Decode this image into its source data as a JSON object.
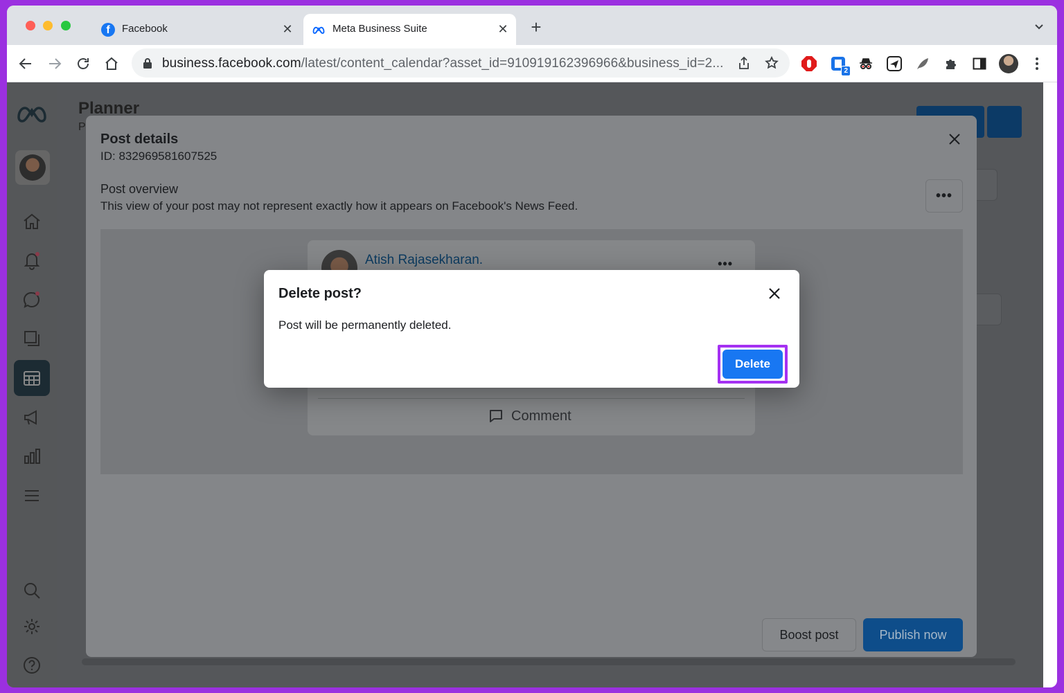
{
  "browser": {
    "tabs": [
      {
        "title": "Facebook",
        "favicon": "facebook-icon",
        "active": false
      },
      {
        "title": "Meta Business Suite",
        "favicon": "meta-icon",
        "active": true
      }
    ],
    "url_host": "business.facebook.com",
    "url_path": "/latest/content_calendar?asset_id=910919162396966&business_id=2...",
    "extension_badge": "2",
    "colors": {
      "tabstrip": "#dee1e6",
      "omnibox": "#f1f3f4",
      "frame": "#9b30e0"
    }
  },
  "page": {
    "planner_title": "Planner",
    "planner_sub": "P"
  },
  "post_details": {
    "title": "Post details",
    "id_text": "ID: 832969581607525",
    "overview_title": "Post overview",
    "overview_desc": "This view of your post may not represent exactly how it appears on Facebook's News Feed.",
    "more_label": "•••",
    "post": {
      "author": "Atish Rajasekharan.",
      "more_label": "•••",
      "comment_label": "Comment"
    },
    "boost_label": "Boost post",
    "publish_label": "Publish now"
  },
  "delete_dialog": {
    "title": "Delete post?",
    "message": "Post will be permanently deleted.",
    "delete_label": "Delete",
    "colors": {
      "button": "#1877f2",
      "highlight": "#a531f2"
    }
  }
}
